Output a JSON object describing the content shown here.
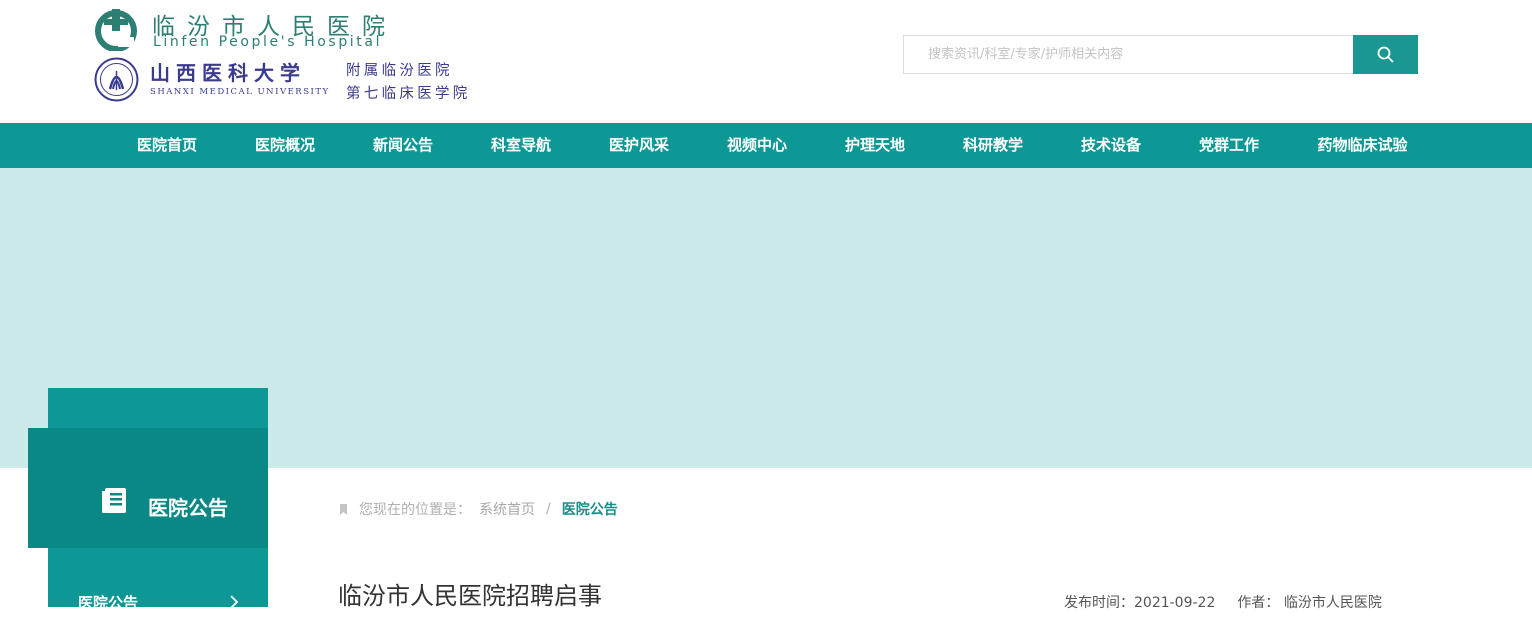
{
  "header": {
    "hospital_name_cn": "临汾市人民医院",
    "hospital_name_en": "Linfen People's Hospital",
    "university_cn": "山西医科大学",
    "university_en": "SHANXI MEDICAL UNIVERSITY",
    "affiliation_line1": "附属临汾医院",
    "affiliation_line2": "第七临床医学院"
  },
  "search": {
    "placeholder": "搜索资讯/科室/专家/护师相关内容",
    "value": ""
  },
  "nav": {
    "items": [
      {
        "label": "医院首页"
      },
      {
        "label": "医院概况"
      },
      {
        "label": "新闻公告"
      },
      {
        "label": "科室导航"
      },
      {
        "label": "医护风采"
      },
      {
        "label": "视频中心"
      },
      {
        "label": "护理天地"
      },
      {
        "label": "科研教学"
      },
      {
        "label": "技术设备"
      },
      {
        "label": "党群工作"
      },
      {
        "label": "药物临床试验"
      }
    ]
  },
  "sidebar": {
    "title": "医院公告",
    "title_icon": "document-icon",
    "links": [
      {
        "label": "医院公告"
      }
    ]
  },
  "breadcrumb": {
    "prefix": "您现在的位置是：",
    "home": "系统首页",
    "separator": "/",
    "current": "医院公告"
  },
  "article": {
    "title": "临汾市人民医院招聘启事",
    "publish": "发布时间：2021-09-22",
    "author": "作者： 临汾市人民医院"
  },
  "colors": {
    "primary": "#0e9895",
    "primary_dark": "#0a8885",
    "banner": "#cdeaea",
    "logo_green": "#2d7f74",
    "logo_purple": "#3b3b8e"
  }
}
